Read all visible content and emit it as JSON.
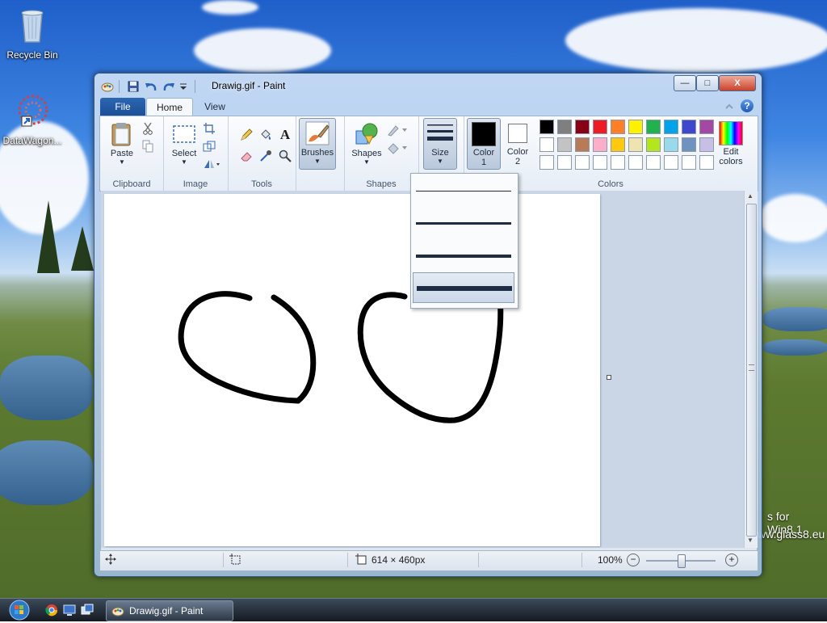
{
  "desktop": {
    "icons": [
      {
        "label": "Recycle Bin",
        "icon": "recycle-bin-icon"
      },
      {
        "label": "DataWagon...",
        "icon": "datawagon-icon"
      }
    ],
    "watermark": {
      "line1": "s for Win8.1",
      "line2": "ww.glass8.eu"
    }
  },
  "window": {
    "title": "Drawig.gif - Paint",
    "quick_access": [
      "paint-app-icon",
      "save-icon",
      "undo-icon",
      "redo-icon",
      "customize-dropdown-icon"
    ],
    "controls": {
      "minimize": "—",
      "maximize": "□",
      "close": "X"
    }
  },
  "ribbon": {
    "tabs": [
      {
        "label": "File",
        "active": false
      },
      {
        "label": "Home",
        "active": true
      },
      {
        "label": "View",
        "active": false
      }
    ],
    "help_icon": "?",
    "groups": {
      "clipboard": {
        "label": "Clipboard",
        "paste": "Paste"
      },
      "image": {
        "label": "Image",
        "select": "Select"
      },
      "tools": {
        "label": "Tools",
        "text_tool": "A"
      },
      "brushes": {
        "label": "Brushes"
      },
      "shapes": {
        "label": "Shapes",
        "button": "Shapes"
      },
      "size": {
        "label": "Size"
      },
      "colors": {
        "label": "Colors",
        "color1_label": "Color",
        "color1_num": "1",
        "color2_label": "Color",
        "color2_num": "2",
        "color1_value": "#000000",
        "color2_value": "#ffffff",
        "edit_label_1": "Edit",
        "edit_label_2": "colors",
        "palette_row1": [
          "#000000",
          "#7f7f7f",
          "#880015",
          "#ed1c24",
          "#ff7f27",
          "#fff200",
          "#22b14c",
          "#00a2e8",
          "#3f48cc",
          "#a349a4"
        ],
        "palette_row2": [
          "#ffffff",
          "#c3c3c3",
          "#b97a57",
          "#ffaec9",
          "#ffc90e",
          "#efe4b0",
          "#b5e61d",
          "#99d9ea",
          "#7092be",
          "#c8bfe7"
        ],
        "palette_row3": [
          "#ffffff",
          "#ffffff",
          "#ffffff",
          "#ffffff",
          "#ffffff",
          "#ffffff",
          "#ffffff",
          "#ffffff",
          "#ffffff",
          "#ffffff"
        ]
      }
    }
  },
  "size_menu": {
    "options": [
      {
        "weight": 1,
        "selected": false
      },
      {
        "weight": 3,
        "selected": false
      },
      {
        "weight": 5,
        "selected": false
      },
      {
        "weight": 8,
        "selected": true
      }
    ]
  },
  "status": {
    "dimensions": "614 × 460px",
    "zoom": "100%",
    "zoom_out": "−",
    "zoom_in": "+",
    "zoom_level_percent": 50
  },
  "taskbar": {
    "task_label": "Drawig.gif - Paint",
    "quick_launch": [
      "chrome-icon",
      "desktop-icon",
      "switch-windows-icon"
    ]
  }
}
